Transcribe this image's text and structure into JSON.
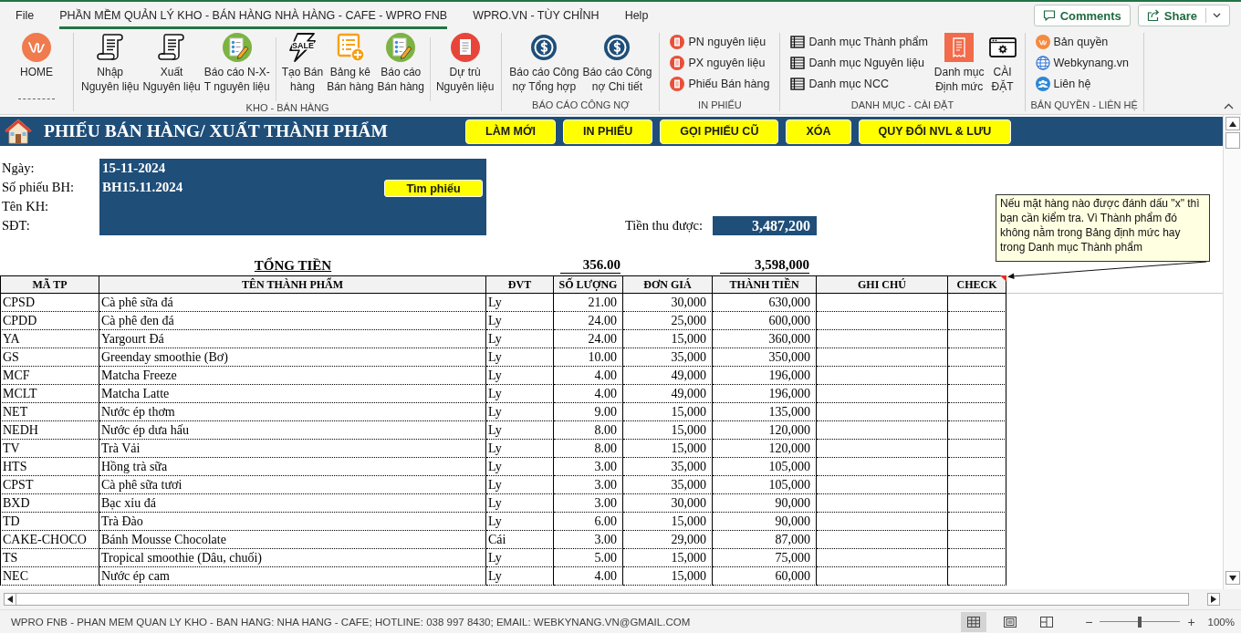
{
  "menu_bar": {
    "tabs": [
      {
        "label": "File",
        "selected": false
      },
      {
        "label": "PHẦN MỀM QUẢN LÝ KHO - BÁN HÀNG NHÀ HÀNG - CAFE - WPRO FNB",
        "selected": true
      },
      {
        "label": "WPRO.VN - TÙY CHỈNH",
        "selected": false
      },
      {
        "label": "Help",
        "selected": false
      }
    ],
    "comments_button": "Comments",
    "share_button": "Share"
  },
  "ribbon": {
    "groups": [
      {
        "buttons": [
          {
            "kind": "large",
            "label": "HOME"
          }
        ]
      },
      {
        "label": "KHO - BÁN HÀNG",
        "buttons": [
          {
            "kind": "large",
            "label": "Nhập\nNguyên liệu"
          },
          {
            "kind": "large",
            "label": "Xuất\nNguyên liệu"
          },
          {
            "kind": "large",
            "label": "Báo cáo N-X-\nT nguyên liệu"
          },
          {
            "kind": "separator"
          },
          {
            "kind": "large",
            "label": "Tạo Bán\nhàng",
            "badge": "SALE"
          },
          {
            "kind": "large",
            "label": "Bảng kê\nBán hàng"
          },
          {
            "kind": "large",
            "label": "Báo cáo\nBán hàng"
          },
          {
            "kind": "separator"
          },
          {
            "kind": "large",
            "label": "Dự trù\nNguyên liệu"
          }
        ]
      },
      {
        "label": "BÁO CÁO CÔNG NỢ",
        "buttons": [
          {
            "kind": "large",
            "label": "Báo cáo Công\nnợ Tổng hợp"
          },
          {
            "kind": "large",
            "label": "Báo cáo Công\nnợ Chi tiết"
          }
        ]
      },
      {
        "label": "IN PHIẾU",
        "buttons": [
          {
            "kind": "small",
            "label": "PN nguyên liệu"
          },
          {
            "kind": "small",
            "label": "PX nguyên liệu"
          },
          {
            "kind": "small",
            "label": "Phiếu Bán hàng"
          }
        ]
      },
      {
        "label": "DANH MỤC - CÀI ĐẶT",
        "buttons": [
          {
            "kind": "small",
            "label": "Danh mục Thành phẩm"
          },
          {
            "kind": "small",
            "label": "Danh mục Nguyên liệu"
          },
          {
            "kind": "small",
            "label": "Danh mục NCC"
          },
          {
            "kind": "large",
            "label": "Danh mục\nĐịnh mức"
          },
          {
            "kind": "large",
            "label": "CÀI\nĐẶT"
          }
        ]
      },
      {
        "label": "BẢN QUYỀN - LIÊN HỆ",
        "buttons": [
          {
            "kind": "small",
            "label": "Bản quyền"
          },
          {
            "kind": "small",
            "label": "Webkynang.vn"
          },
          {
            "kind": "small",
            "label": "Liên hệ"
          }
        ]
      }
    ]
  },
  "sheet": {
    "title": "PHIẾU BÁN HÀNG/ XUẤT THÀNH PHẨM",
    "actions": [
      "LÀM MỚI",
      "IN PHIẾU",
      "GỌI PHIẾU CŨ",
      "XÓA",
      "QUY ĐỔI NVL & LƯU"
    ],
    "info": [
      {
        "label": "Ngày:",
        "value": "15-11-2024"
      },
      {
        "label": "Số phiếu BH:",
        "value": "BH15.11.2024"
      },
      {
        "label": "Tên KH:"
      },
      {
        "label": "SĐT:"
      }
    ],
    "search_button": "Tìm phiếu",
    "received": {
      "label": "Tiền thu được:",
      "value": "3,487,200"
    },
    "note": "Nếu mặt hàng nào được đánh dấu \"x\" thì bạn cần kiểm tra. Vì Thành phẩm đó không nằm trong Bảng định mức hay trong Danh mục Thành phẩm",
    "totals": {
      "label": "TỔNG TIỀN",
      "quantity": "356.00",
      "amount": "3,598,000"
    },
    "table": {
      "columns": [
        "MÃ TP",
        "TÊN THÀNH PHẨM",
        "ĐVT",
        "SỐ LƯỢNG",
        "ĐƠN GIÁ",
        "THÀNH TIỀN",
        "GHI CHÚ",
        "CHECK"
      ],
      "rows": [
        [
          "CPSD",
          "Cà phê sữa đá",
          "Ly",
          "21.00",
          "30,000",
          "630,000"
        ],
        [
          "CPDD",
          "Cà phê đen đá",
          "Ly",
          "24.00",
          "25,000",
          "600,000"
        ],
        [
          "YA",
          "Yargourt Đá",
          "Ly",
          "24.00",
          "15,000",
          "360,000"
        ],
        [
          "GS",
          "Greenday smoothie (Bơ)",
          "Ly",
          "10.00",
          "35,000",
          "350,000"
        ],
        [
          "MCF",
          "Matcha Freeze",
          "Ly",
          "4.00",
          "49,000",
          "196,000"
        ],
        [
          "MCLT",
          "Matcha Latte",
          "Ly",
          "4.00",
          "49,000",
          "196,000"
        ],
        [
          "NET",
          "Nước ép thơm",
          "Ly",
          "9.00",
          "15,000",
          "135,000"
        ],
        [
          "NEDH",
          "Nước ép dưa hấu",
          "Ly",
          "8.00",
          "15,000",
          "120,000"
        ],
        [
          "TV",
          "Trà Vải",
          "Ly",
          "8.00",
          "15,000",
          "120,000"
        ],
        [
          "HTS",
          "Hồng trà sữa",
          "Ly",
          "3.00",
          "35,000",
          "105,000"
        ],
        [
          "CPST",
          "Cà phê sữa tươi",
          "Ly",
          "3.00",
          "35,000",
          "105,000"
        ],
        [
          "BXD",
          "Bạc xỉu đá",
          "Ly",
          "3.00",
          "30,000",
          "90,000"
        ],
        [
          "TD",
          "Trà Đào",
          "Ly",
          "6.00",
          "15,000",
          "90,000"
        ],
        [
          "CAKE-CHOCO",
          "Bánh Mousse Chocolate",
          "Cái",
          "3.00",
          "29,000",
          "87,000"
        ],
        [
          "TS",
          "Tropical smoothie (Dâu, chuối)",
          "Ly",
          "5.00",
          "15,000",
          "75,000"
        ],
        [
          "NEC",
          "Nước ép cam",
          "Ly",
          "4.00",
          "15,000",
          "60,000"
        ]
      ]
    }
  },
  "status_bar": {
    "text": "WPRO FNB - PHAN MEM QUAN LY KHO - BAN HANG: NHA HANG - CAFE; HOTLINE: 038 997 8430; EMAIL: WEBKYNANG.VN@GMAIL.COM",
    "views": [
      {
        "kind": "normal",
        "selected": true
      },
      {
        "kind": "page_layout",
        "selected": false
      },
      {
        "kind": "page_break",
        "selected": false
      }
    ],
    "zoom": {
      "out": "−",
      "in": "+",
      "level": 0.5,
      "reading": "100%"
    }
  }
}
